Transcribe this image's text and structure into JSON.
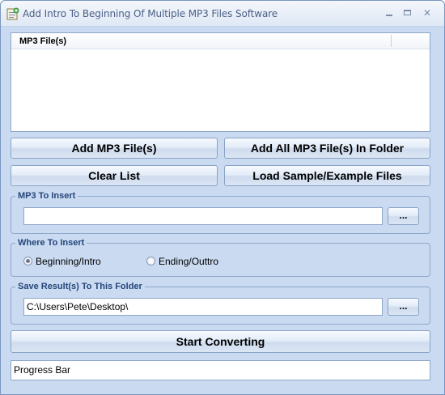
{
  "window": {
    "title": "Add Intro To Beginning Of Multiple MP3 Files Software",
    "controls": {
      "minimize": "minimize",
      "maximize": "maximize",
      "close": "✕"
    }
  },
  "file_list": {
    "columns": [
      "MP3 File(s)"
    ],
    "rows": []
  },
  "buttons": {
    "add_files": "Add MP3 File(s)",
    "add_folder": "Add All MP3 File(s) In Folder",
    "clear_list": "Clear List",
    "load_sample": "Load Sample/Example Files",
    "start": "Start Converting"
  },
  "mp3_to_insert": {
    "legend": "MP3 To Insert",
    "value": "",
    "browse_label": "..."
  },
  "where_to_insert": {
    "legend": "Where To Insert",
    "options": [
      {
        "label": "Beginning/Intro",
        "checked": true
      },
      {
        "label": "Ending/Outtro",
        "checked": false
      }
    ]
  },
  "save_folder": {
    "legend": "Save Result(s) To This Folder",
    "value": "C:\\Users\\Pete\\Desktop\\",
    "browse_label": "..."
  },
  "progress": {
    "label": "Progress Bar"
  },
  "colors": {
    "window_bg": "#c9daf1",
    "group_legend": "#26467a",
    "border": "#8ea7c8"
  }
}
